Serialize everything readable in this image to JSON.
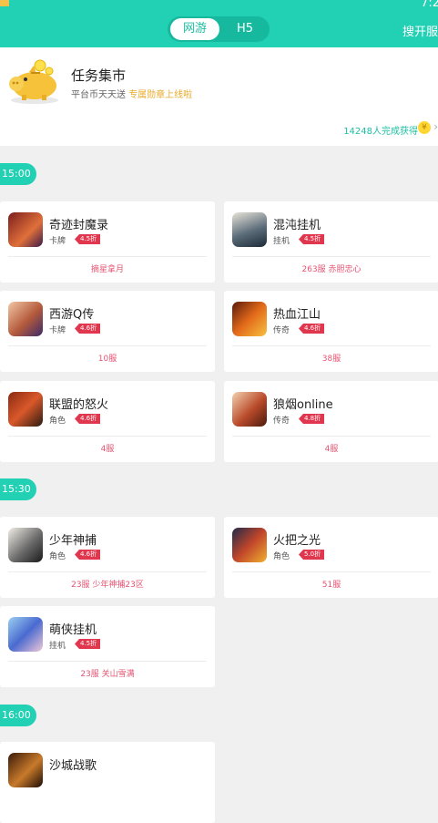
{
  "status_bar": {
    "time": "7:2"
  },
  "header": {
    "tabs": [
      {
        "label": "网游",
        "active": true
      },
      {
        "label": "H5",
        "active": false
      }
    ],
    "right_action": "搜开服",
    "accent_color": "#22d0b4"
  },
  "task": {
    "title": "任务集市",
    "subtitle_prefix": "平台币天天送 ",
    "subtitle_highlight": "专属勋章上线啦",
    "progress_text": "14248人完成获得",
    "coin_symbol": "¥",
    "icons": {
      "banner": "piggy-bank-icon",
      "coin": "coin-icon",
      "more": "chevron-right-icon"
    }
  },
  "schedule": [
    {
      "time": "15:00",
      "games": [
        {
          "name": "奇迹封魔录",
          "category": "卡牌",
          "rating": "4.5折",
          "server": "摘星拿月"
        },
        {
          "name": "混沌挂机",
          "category": "挂机",
          "rating": "4.5折",
          "server": "263服 赤胆忠心"
        },
        {
          "name": "西游Q传",
          "category": "卡牌",
          "rating": "4.6折",
          "server": "10服"
        },
        {
          "name": "热血江山",
          "category": "传奇",
          "rating": "4.6折",
          "server": "38服"
        },
        {
          "name": "联盟的怒火",
          "category": "角色",
          "rating": "4.6折",
          "server": "4服"
        },
        {
          "name": "狼烟online",
          "category": "传奇",
          "rating": "4.8折",
          "server": "4服"
        }
      ]
    },
    {
      "time": "15:30",
      "games": [
        {
          "name": "少年神捕",
          "category": "角色",
          "rating": "4.6折",
          "server": "23服 少年神捕23区"
        },
        {
          "name": "火把之光",
          "category": "角色",
          "rating": "5.0折",
          "server": "51服"
        },
        {
          "name": "萌侠挂机",
          "category": "挂机",
          "rating": "4.5折",
          "server": "23服 关山雪满"
        }
      ]
    },
    {
      "time": "16:00",
      "games": [
        {
          "name": "沙城战歌"
        }
      ]
    }
  ]
}
